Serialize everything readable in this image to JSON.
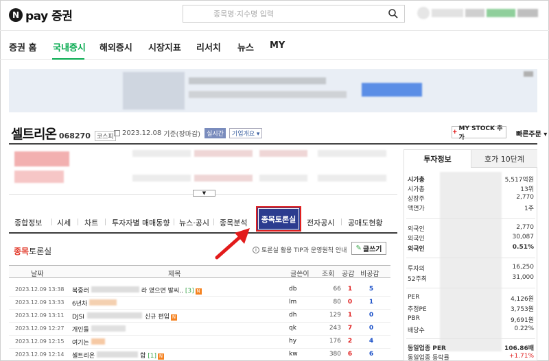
{
  "header": {
    "logo_letter": "N",
    "logo_text": "pay 증권",
    "search_placeholder": "종목명·지수명 입력"
  },
  "nav": {
    "items": [
      {
        "label": "증권 홈"
      },
      {
        "label": "국내증시"
      },
      {
        "label": "해외증시"
      },
      {
        "label": "시장지표"
      },
      {
        "label": "리서치"
      },
      {
        "label": "뉴스"
      },
      {
        "label": "MY"
      }
    ],
    "active": "국내증시"
  },
  "stock": {
    "name": "셀트리온",
    "code": "068270",
    "market": "코스피",
    "date": "2023.12.08",
    "date_suffix": "기준(장마감)",
    "realtime_label": "실시간",
    "company_label": "기업개요",
    "mystock_label": "MY STOCK 추가",
    "quickorder_label": "빠른주문"
  },
  "subtabs": {
    "items": [
      "종합정보",
      "시세",
      "차트",
      "투자자별 매매동향",
      "뉴스·공시",
      "종목분석",
      "종목토론실",
      "전자공시",
      "공매도현황"
    ],
    "active": "종목토론실"
  },
  "board": {
    "title_highlight": "종목",
    "title_rest": "토론실",
    "tip": "토론실 활용 TIP과 운영원칙 안내",
    "write_label": "글쓰기",
    "columns": [
      "날짜",
      "제목",
      "글쓴이",
      "조회",
      "공감",
      "비공감"
    ],
    "rows": [
      {
        "date": "2023.12.09 13:38",
        "title": "북중러",
        "title_tail": "라 였으면 발씨..",
        "comments": "[3]",
        "new": "N",
        "writer": "db",
        "views": "66",
        "likes": "1",
        "dislikes": "5"
      },
      {
        "date": "2023.12.09 13:33",
        "title": "6년차",
        "title_tail": "",
        "comments": "",
        "new": "",
        "writer": "lm",
        "views": "80",
        "likes": "0",
        "dislikes": "1"
      },
      {
        "date": "2023.12.09 13:11",
        "title": "DJSI",
        "title_tail": "신규 편입",
        "comments": "",
        "new": "N",
        "writer": "dh",
        "views": "129",
        "likes": "1",
        "dislikes": "0"
      },
      {
        "date": "2023.12.09 12:27",
        "title": "개인들",
        "title_tail": "",
        "comments": "",
        "new": "",
        "writer": "qk",
        "views": "243",
        "likes": "7",
        "dislikes": "0"
      },
      {
        "date": "2023.12.09 12:15",
        "title": "여기는",
        "title_tail": "",
        "comments": "",
        "new": "N",
        "writer": "hy",
        "views": "176",
        "likes": "2",
        "dislikes": "4"
      },
      {
        "date": "2023.12.09 12:14",
        "title": "셀트리온",
        "title_tail": "합",
        "comments": "[1]",
        "new": "N",
        "writer": "kw",
        "views": "380",
        "likes": "6",
        "dislikes": "6"
      }
    ]
  },
  "right_panel": {
    "tab_active": "투자정보",
    "tab_inactive": "호가 10단계",
    "rows": [
      {
        "label": "시가총",
        "value": "5,517억원",
        "bold": true
      },
      {
        "label": "시가총",
        "value": "13위"
      },
      {
        "label": "상장주",
        "value": "2,770"
      },
      {
        "label": "액면가",
        "value": "1주"
      },
      {
        "label": "외국인",
        "value": "2,770"
      },
      {
        "label": "외국인",
        "value": "30,087"
      },
      {
        "label": "외국인",
        "value": "0.51%",
        "bold": true
      },
      {
        "label": "투자의",
        "value": "16,250"
      },
      {
        "label": "52주최",
        "value": "31,000"
      },
      {
        "label": "PER",
        "value": "4,126원"
      },
      {
        "label": "추정PE",
        "value": "3,753원"
      },
      {
        "label": "PBR",
        "value": "9,691원"
      },
      {
        "label": "배당수",
        "value": "0.22%"
      },
      {
        "label": "동일업종 PER",
        "value": "106.86배",
        "bold": true
      },
      {
        "label": "동일업종 등락률",
        "value": "+1.71%",
        "red": true
      }
    ]
  }
}
